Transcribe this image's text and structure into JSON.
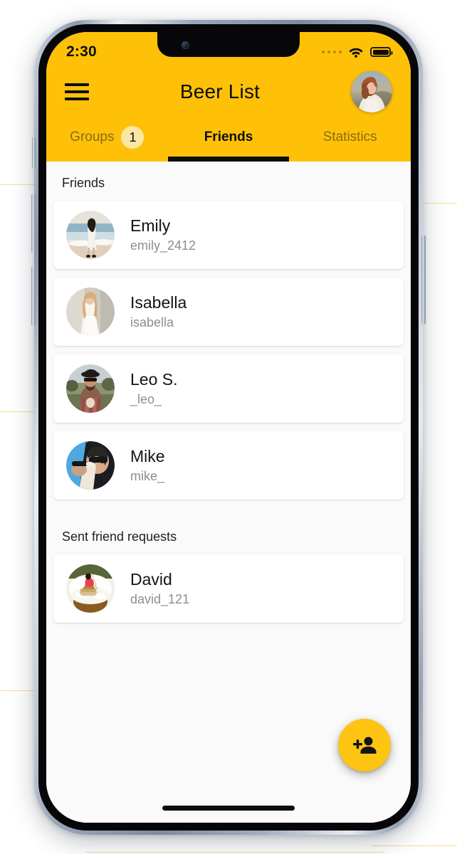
{
  "status_bar": {
    "time": "2:30",
    "signal_icon": "signal-dots-icon",
    "wifi_icon": "wifi-icon",
    "battery_icon": "battery-full-icon"
  },
  "header": {
    "menu_icon": "hamburger-menu-icon",
    "title": "Beer List",
    "profile_avatar": "user-profile-avatar"
  },
  "tabs": [
    {
      "label": "Groups",
      "badge": "1",
      "active": false
    },
    {
      "label": "Friends",
      "badge": "",
      "active": true
    },
    {
      "label": "Statistics",
      "badge": "",
      "active": false
    }
  ],
  "sections": [
    {
      "heading": "Friends",
      "items": [
        {
          "name": "Emily",
          "username": "emily_2412",
          "avatar": "avatar-emily"
        },
        {
          "name": "Isabella",
          "username": "isabella",
          "avatar": "avatar-isabella"
        },
        {
          "name": "Leo S.",
          "username": "_leo_",
          "avatar": "avatar-leo"
        },
        {
          "name": "Mike",
          "username": "mike_",
          "avatar": "avatar-mike"
        }
      ]
    },
    {
      "heading": "Sent friend requests",
      "items": [
        {
          "name": "David",
          "username": "david_121",
          "avatar": "avatar-david"
        }
      ]
    }
  ],
  "fab": {
    "icon": "person-add-icon",
    "label": "Add friend"
  },
  "colors": {
    "accent": "#FFC107",
    "fab": "#FDC412",
    "badge": "#FBE7A3",
    "tab_inactive_text": "#8A6C11",
    "tab_active_text": "#0D0D0D",
    "content_bg": "#FAFAFA",
    "card_bg": "#FFFFFF",
    "name_text": "#141414",
    "username_text": "#8D8D8D"
  }
}
